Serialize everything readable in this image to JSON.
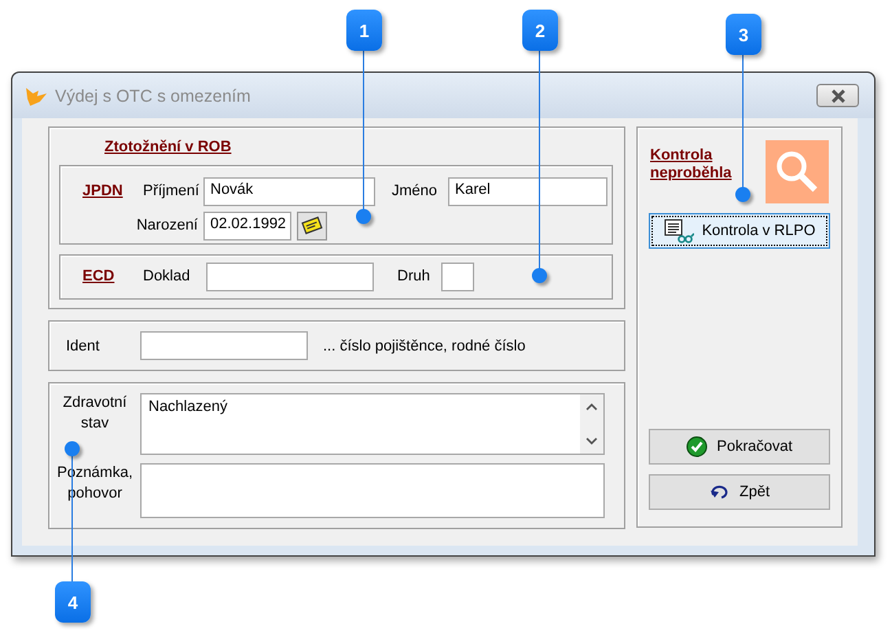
{
  "window": {
    "title": "Výdej s OTC s omezením"
  },
  "rob_group": {
    "title": "Ztotožnění v ROB",
    "jpdn": {
      "link": "JPDN",
      "surname_label": "Příjmení",
      "surname": "Novák",
      "name_label": "Jméno",
      "name": "Karel",
      "birth_label": "Narození",
      "birth": "02.02.1992"
    },
    "ecd": {
      "link": "ECD",
      "document_label": "Doklad",
      "type_label": "Druh"
    }
  },
  "ident": {
    "label": "Ident",
    "hint": "... číslo pojištěnce, rodné číslo"
  },
  "health": {
    "label": "Zdravotní stav",
    "value": "Nachlazený"
  },
  "note": {
    "label": "Poznámka, pohovor"
  },
  "side": {
    "status_link": "Kontrola neproběhla",
    "check_button": "Kontrola v RLPO",
    "continue_button": "Pokračovat",
    "back_button": "Zpět"
  },
  "callouts": [
    {
      "label": "1"
    },
    {
      "label": "2"
    },
    {
      "label": "3"
    },
    {
      "label": "4"
    }
  ]
}
